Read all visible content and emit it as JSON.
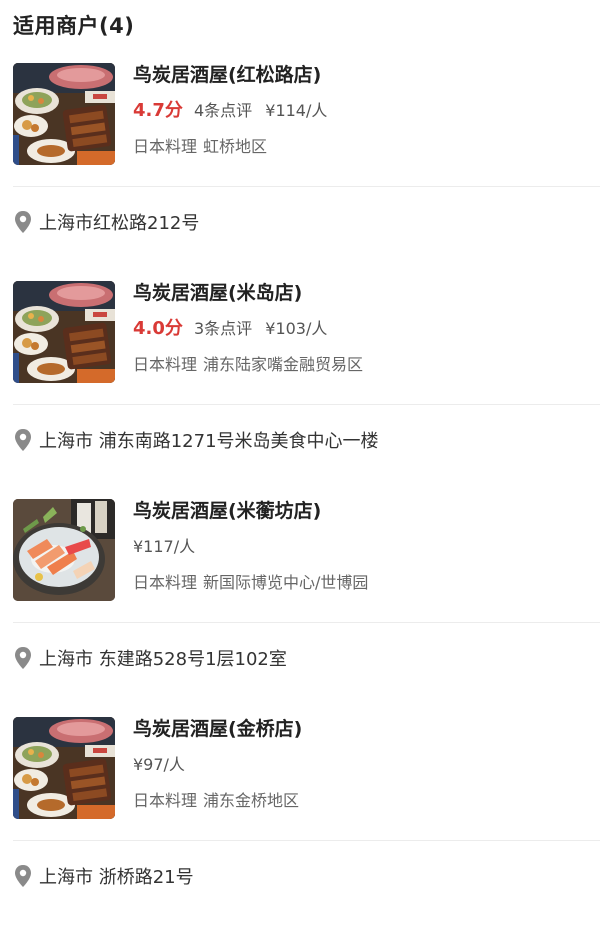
{
  "header": {
    "title": "适用商户(4)"
  },
  "merchants": [
    {
      "name": "鸟炭居酒屋(红松路店)",
      "score": "4.7分",
      "reviews": "4条点评",
      "price": "¥114/人",
      "cuisine": "日本料理",
      "area": "虹桥地区",
      "address": "上海市红松路212号",
      "image_icon": "grill-dishes-photo"
    },
    {
      "name": "鸟炭居酒屋(米岛店)",
      "score": "4.0分",
      "reviews": "3条点评",
      "price": "¥103/人",
      "cuisine": "日本料理",
      "area": "浦东陆家嘴金融贸易区",
      "address": "上海市 浦东南路1271号米岛美食中心一楼",
      "image_icon": "grill-dishes-photo"
    },
    {
      "name": "鸟炭居酒屋(米蘅坊店)",
      "score": "",
      "reviews": "",
      "price": "¥117/人",
      "cuisine": "日本料理",
      "area": "新国际博览中心/世博园",
      "address": "上海市 东建路528号1层102室",
      "image_icon": "sashimi-platter-photo"
    },
    {
      "name": "鸟炭居酒屋(金桥店)",
      "score": "",
      "reviews": "",
      "price": "¥97/人",
      "cuisine": "日本料理",
      "area": "浦东金桥地区",
      "address": "上海市 浙桥路21号",
      "image_icon": "grill-dishes-photo"
    }
  ],
  "colors": {
    "score_red": "#d93a36",
    "divider": "#ececec",
    "pin_gray": "#8a8a8a"
  }
}
